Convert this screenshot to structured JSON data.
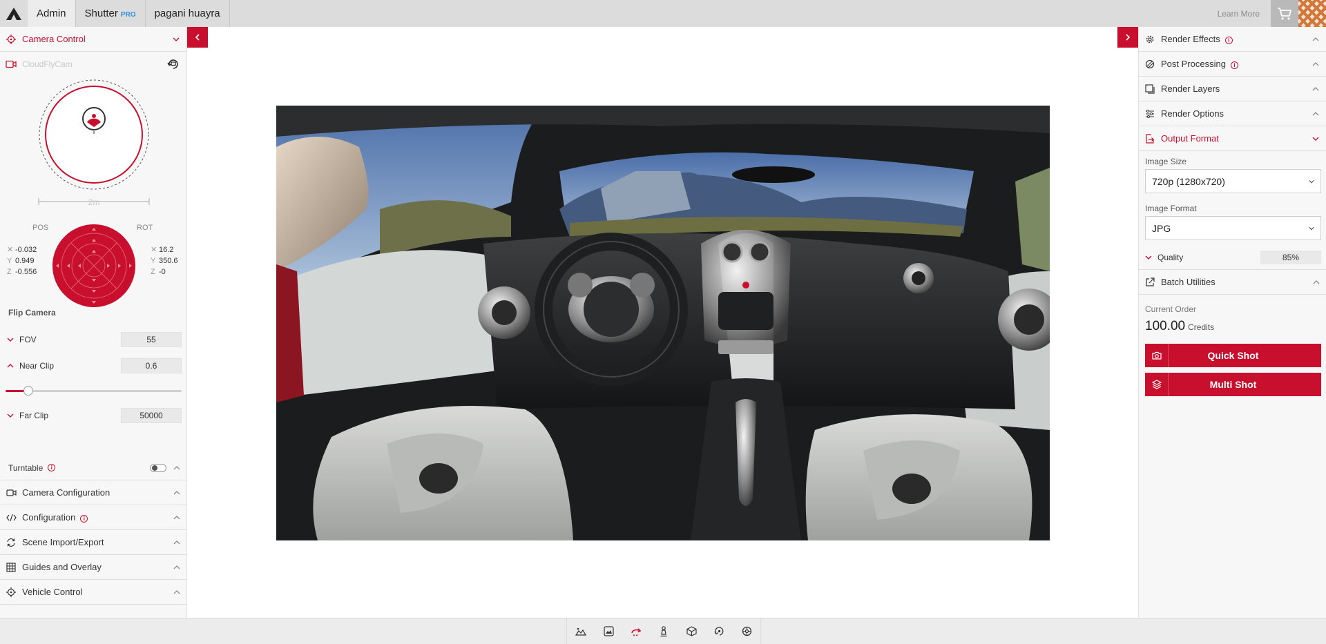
{
  "topbar": {
    "tabs": [
      {
        "label": "Admin"
      },
      {
        "label": "Shutter",
        "badge": "PRO"
      },
      {
        "label": "pagani huayra"
      }
    ],
    "learn_more": "Learn More"
  },
  "left_panel": {
    "camera_control": "Camera Control",
    "camera_name": "CloudFlyCam",
    "orbit_scale": "2m",
    "pos_label": "POS",
    "rot_label": "ROT",
    "position": {
      "x": "-0.032",
      "y": "0.949",
      "z": "-0.556"
    },
    "rotation": {
      "x": "16.2",
      "y": "350.6",
      "z": "-0"
    },
    "flip_camera": "Flip Camera",
    "fov": {
      "label": "FOV",
      "value": "55"
    },
    "near_clip": {
      "label": "Near Clip",
      "value": "0.6",
      "slider_fraction": 0.13
    },
    "far_clip": {
      "label": "Far Clip",
      "value": "50000"
    },
    "turntable": {
      "label": "Turntable",
      "enabled": false
    },
    "sections": [
      {
        "label": "Camera Configuration",
        "icon": "camera-icon"
      },
      {
        "label": "Configuration",
        "icon": "code-icon",
        "info": true
      },
      {
        "label": "Scene Import/Export",
        "icon": "sync-icon"
      },
      {
        "label": "Guides and Overlay",
        "icon": "grid-icon"
      },
      {
        "label": "Vehicle Control",
        "icon": "vehicle-icon"
      }
    ]
  },
  "viewport": {
    "scene": "pagani-huayra-interior"
  },
  "right_panel": {
    "sections": [
      {
        "label": "Render Effects",
        "icon": "gear-icon",
        "info": true
      },
      {
        "label": "Post Processing",
        "icon": "filter-icon",
        "info": true
      },
      {
        "label": "Render Layers",
        "icon": "layers-icon"
      },
      {
        "label": "Render Options",
        "icon": "sliders-icon"
      }
    ],
    "output_format": "Output Format",
    "image_size_label": "Image Size",
    "image_size_value": "720p (1280x720)",
    "image_format_label": "Image Format",
    "image_format_value": "JPG",
    "quality_label": "Quality",
    "quality_value": "85%",
    "batch_utilities": "Batch Utilities",
    "current_order_label": "Current Order",
    "credits_value": "100.00",
    "credits_unit": "Credits",
    "quick_shot": "Quick Shot",
    "multi_shot": "Multi Shot"
  },
  "bottom_toolbar": {
    "tools": [
      "landscape-icon",
      "image-icon",
      "orbit-icon",
      "pawn-icon",
      "cube-icon",
      "rotate-icon",
      "wheel-icon"
    ],
    "active_tool": "orbit-icon"
  },
  "colors": {
    "accent": "#c8102e",
    "topbar": "#dcdcdc",
    "panel": "#f7f7f7",
    "pro_badge": "#2a8fd6"
  }
}
